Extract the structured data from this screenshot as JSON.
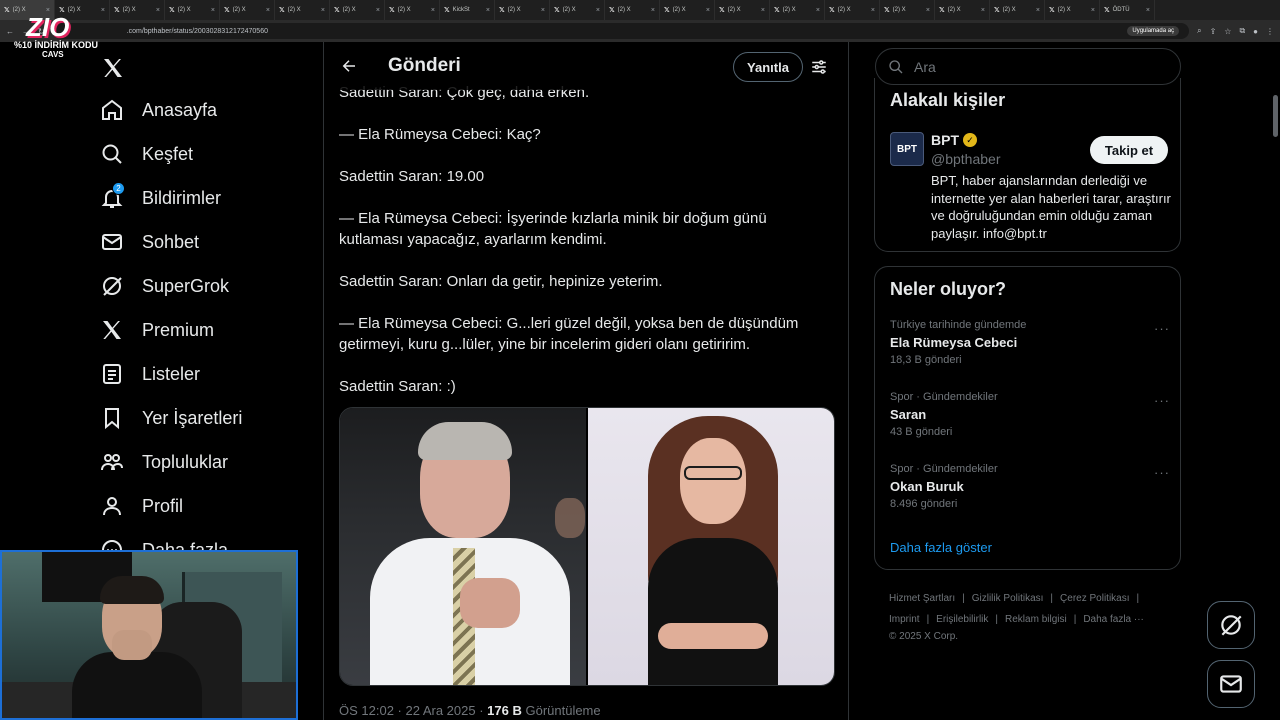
{
  "browser": {
    "tabs": [
      {
        "label": "(2) X",
        "active": true
      },
      {
        "label": "(2) X"
      },
      {
        "label": "(2) X"
      },
      {
        "label": "(2) X"
      },
      {
        "label": "(2) X"
      },
      {
        "label": "(2) X"
      },
      {
        "label": "(2) X"
      },
      {
        "label": "(2) X"
      },
      {
        "label": "KickSt"
      },
      {
        "label": "(2) X"
      },
      {
        "label": "(2) X"
      },
      {
        "label": "(2) X"
      },
      {
        "label": "(2) X"
      },
      {
        "label": "(2) X"
      },
      {
        "label": "(2) X"
      },
      {
        "label": "(2) X"
      },
      {
        "label": "(2) X"
      },
      {
        "label": "(2) X"
      },
      {
        "label": "(2) X"
      },
      {
        "label": "(2) X"
      },
      {
        "label": "ÖDTÜ"
      }
    ],
    "url": ".com/bpthaber/status/2003028312172470560",
    "app_chip": "Uygulamada aç"
  },
  "overlay": {
    "logo": "ZIO",
    "promo": "%10 İNDİRİM KODU",
    "code": "CAVS"
  },
  "nav": {
    "items": [
      {
        "label": "Anasayfa",
        "icon": "home-icon"
      },
      {
        "label": "Keşfet",
        "icon": "search-icon"
      },
      {
        "label": "Bildirimler",
        "icon": "bell-icon",
        "badge": "2"
      },
      {
        "label": "Sohbet",
        "icon": "mail-icon"
      },
      {
        "label": "SuperGrok",
        "icon": "grok-icon"
      },
      {
        "label": "Premium",
        "icon": "x-logo-icon"
      },
      {
        "label": "Listeler",
        "icon": "list-icon"
      },
      {
        "label": "Yer İşaretleri",
        "icon": "bookmark-icon"
      },
      {
        "label": "Topluluklar",
        "icon": "people-icon"
      },
      {
        "label": "Profil",
        "icon": "person-icon"
      },
      {
        "label": "Daha fazla",
        "icon": "more-icon"
      }
    ]
  },
  "post": {
    "header_title": "Gönderi",
    "reply_label": "Yanıtla",
    "paragraphs": [
      "Sadettin Saran: Çok geç, daha erken.",
      "— Ela Rümeysa Cebeci: Kaç?",
      "Sadettin Saran: 19.00",
      "— Ela Rümeysa Cebeci: İşyerinde kızlarla minik bir doğum günü kutlaması yapacağız, ayarlarım kendimi.",
      "Sadettin Saran: Onları da getir, hepinize yeterim.",
      "— Ela Rümeysa Cebeci: G...leri güzel değil, yoksa ben de düşündüm getirmeyi, kuru g...lüler, yine bir incelerim gideri olanı getiririm.",
      "Sadettin Saran: :)"
    ],
    "meta_time": "ÖS 12:02 · 22 Ara 2025 · ",
    "meta_views": "176 B",
    "meta_views_label": " Görüntüleme"
  },
  "sidebar": {
    "search_placeholder": "Ara",
    "related_title": "Alakalı kişiler",
    "related": {
      "avatar_text": "BPT",
      "name": "BPT",
      "handle": "@bpthaber",
      "follow_label": "Takip et",
      "bio": "BPT, haber ajanslarından derlediği ve internette yer alan haberleri tarar, araştırır ve doğruluğundan emin olduğu zaman paylaşır. info@bpt.tr"
    },
    "trends_title": "Neler oluyor?",
    "trends": [
      {
        "context": "Türkiye tarihinde gündemde",
        "topic": "Ela Rümeysa Cebeci",
        "count": "18,3 B gönderi"
      },
      {
        "context": "Spor · Gündemdekiler",
        "topic": "Saran",
        "count": "43 B gönderi"
      },
      {
        "context": "Spor · Gündemdekiler",
        "topic": "Okan Buruk",
        "count": "8.496 gönderi"
      }
    ],
    "show_more": "Daha fazla göster",
    "footer_links": [
      "Hizmet Şartları",
      "Gizlilik Politikası",
      "Çerez Politikası",
      "Imprint",
      "Erişilebilirlik",
      "Reklam bilgisi",
      "Daha fazla ···"
    ],
    "copyright": "© 2025 X Corp."
  },
  "colors": {
    "accent": "#1d9bf0",
    "background": "#000000",
    "border": "#2f3336",
    "muted": "#71767b",
    "verified": "#e2b719"
  }
}
